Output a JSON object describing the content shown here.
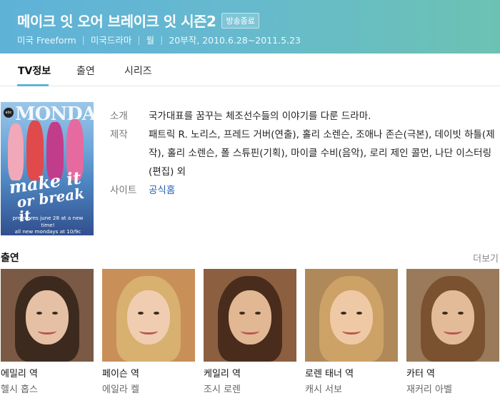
{
  "header": {
    "title": "메이크 잇 오어 브레이크 잇 시즌2",
    "badge": "방송종료",
    "meta": [
      "미국 Freeform",
      "미국드라마",
      "월",
      "20부작, 2010.6.28~2011.5.23"
    ],
    "gradient": [
      "#5fb2d7",
      "#6cc2b2"
    ]
  },
  "tabs": [
    "TV정보",
    "출연",
    "시리즈"
  ],
  "active_tab_index": 0,
  "poster": {
    "network_text": "MONDAYS",
    "logo_line1": "make it",
    "logo_line2": "or break it",
    "premiere_line1": "premieres june 28 at a new time!",
    "premiere_line2": "all new mondays at 10/9c"
  },
  "info": {
    "intro_label": "소개",
    "intro_value": "국가대표를 꿈꾸는 체조선수들의 이야기를 다룬 드라마.",
    "production_label": "제작",
    "production_value": "패트릭 R. 노리스, 프레드 거버(연출), 홀리 소렌슨, 조애나 존슨(극본), 데이빗 하틀(제작), 홀리 소렌슨, 폴 스튜핀(기획), 마이클 수비(음악), 로리 제인 콜먼, 나단 이스터링(편집) 외",
    "site_label": "사이트",
    "site_value": "공식홈"
  },
  "cast": {
    "title": "출연",
    "more_label": "더보기",
    "members": [
      {
        "role": "에밀리 역",
        "name": "헬시 홉스",
        "bg": "#7a5a44",
        "hair": "#3d2a1e",
        "skin": "#e6c0a4"
      },
      {
        "role": "페이슨 역",
        "name": "에일라 켈",
        "bg": "#c98f58",
        "hair": "#d8b070",
        "skin": "#f0cdb0"
      },
      {
        "role": "케일리 역",
        "name": "조시 로렌",
        "bg": "#8c5f40",
        "hair": "#4a2c1c",
        "skin": "#e2b794"
      },
      {
        "role": "로렌 태너 역",
        "name": "캐시 서보",
        "bg": "#b0895a",
        "hair": "#cda267",
        "skin": "#efc9a6"
      },
      {
        "role": "카터 역",
        "name": "재커리 아벨",
        "bg": "#9a7a5a",
        "hair": "#7a5230",
        "skin": "#e3bb98"
      }
    ]
  }
}
